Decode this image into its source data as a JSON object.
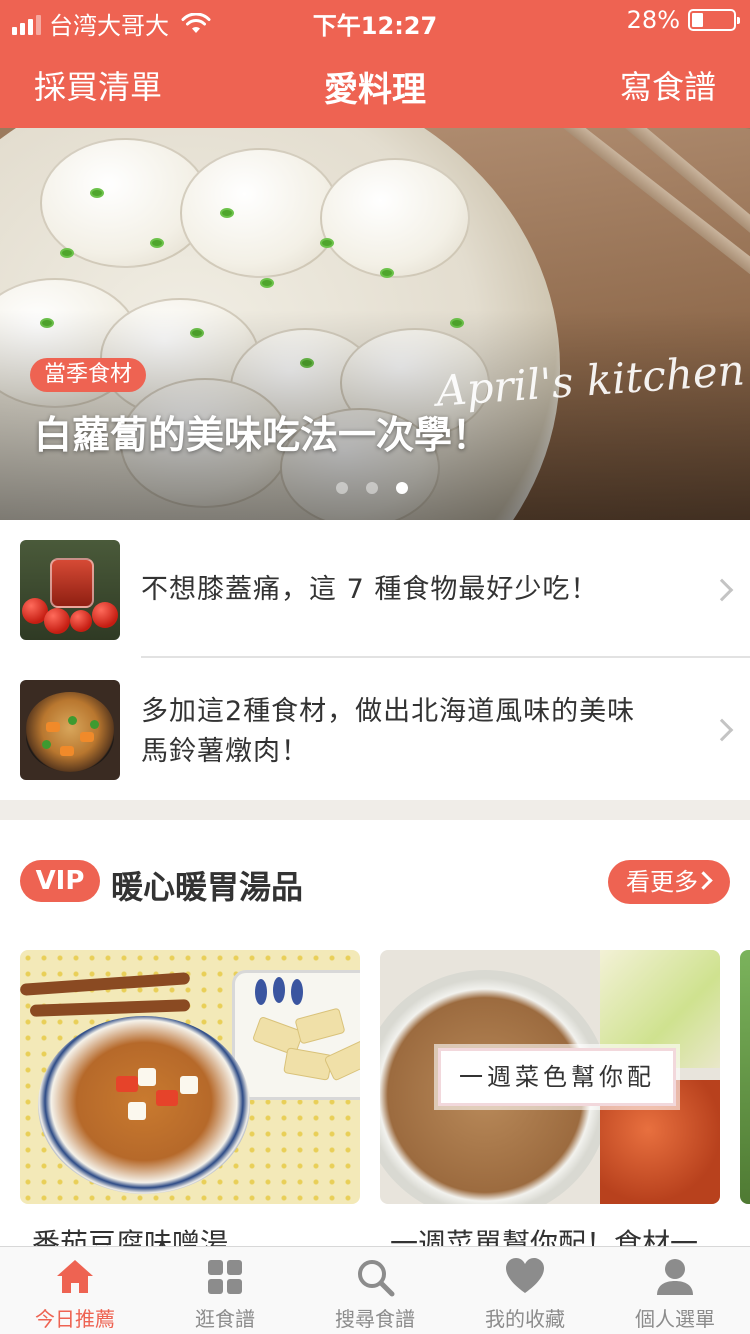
{
  "status_bar": {
    "carrier": "台湾大哥大",
    "time": "下午12:27",
    "battery": "28%",
    "battery_level": 0.28
  },
  "nav": {
    "left_label": "採買清單",
    "title": "愛料理",
    "right_label": "寫食譜"
  },
  "hero": {
    "signature": "April's kitchen",
    "badge": "當季食材",
    "title": "白蘿蔔的美味吃法一次學！",
    "carousel": {
      "count": 3,
      "active_index": 2
    }
  },
  "articles": [
    {
      "title": "不想膝蓋痛，這 7 種食物最好少吃！"
    },
    {
      "title_line1": "多加這2種食材，做出北海道風味的美味",
      "title_line2": "馬鈴薯燉肉！"
    }
  ],
  "section": {
    "badge": "VIP",
    "title": "暖心暖胃湯品",
    "more_label": "看更多"
  },
  "cards": [
    {
      "caption": "番茄豆腐味噌湯"
    },
    {
      "overlay_label": "一週菜色幫你配",
      "caption": "一週菜單幫你配！食材一"
    }
  ],
  "tabs": [
    {
      "label": "今日推薦",
      "icon": "home-icon",
      "active": true
    },
    {
      "label": "逛食譜",
      "icon": "grid-icon",
      "active": false
    },
    {
      "label": "搜尋食譜",
      "icon": "search-icon",
      "active": false
    },
    {
      "label": "我的收藏",
      "icon": "heart-icon",
      "active": false
    },
    {
      "label": "個人選單",
      "icon": "person-icon",
      "active": false
    }
  ],
  "colors": {
    "brand": "#ee6352",
    "tab_inactive": "#8c8c8c",
    "section_gap": "#f0ede8"
  }
}
